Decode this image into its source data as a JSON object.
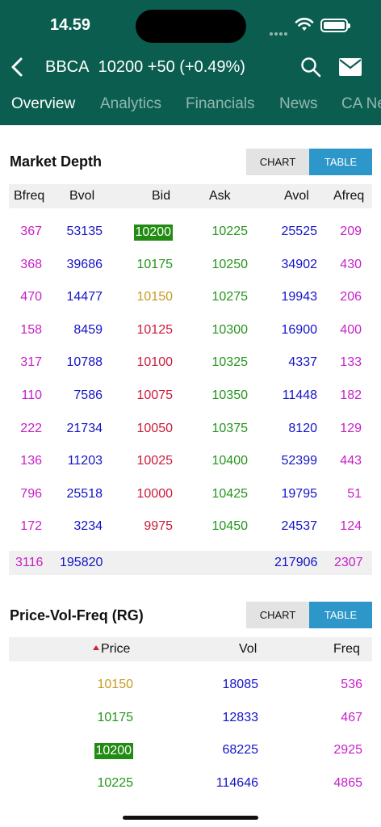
{
  "status_bar": {
    "time": "14.59"
  },
  "header": {
    "ticker": "BBCA",
    "quote": "10200 +50 (+0.49%)"
  },
  "tabs": [
    {
      "label": "Overview",
      "active": true
    },
    {
      "label": "Analytics",
      "active": false
    },
    {
      "label": "Financials",
      "active": false
    },
    {
      "label": "News",
      "active": false
    },
    {
      "label": "CA News",
      "active": false
    }
  ],
  "market_depth": {
    "title": "Market Depth",
    "toggle": {
      "chart": "CHART",
      "table": "TABLE",
      "selected": "TABLE"
    },
    "columns": [
      "Bfreq",
      "Bvol",
      "Bid",
      "Ask",
      "Avol",
      "Afreq"
    ],
    "rows": [
      {
        "bfreq": "367",
        "bvol": "53135",
        "bid": "10200",
        "ask": "10225",
        "avol": "25525",
        "afreq": "209"
      },
      {
        "bfreq": "368",
        "bvol": "39686",
        "bid": "10175",
        "ask": "10250",
        "avol": "34902",
        "afreq": "430"
      },
      {
        "bfreq": "470",
        "bvol": "14477",
        "bid": "10150",
        "ask": "10275",
        "avol": "19943",
        "afreq": "206"
      },
      {
        "bfreq": "158",
        "bvol": "8459",
        "bid": "10125",
        "ask": "10300",
        "avol": "16900",
        "afreq": "400"
      },
      {
        "bfreq": "317",
        "bvol": "10788",
        "bid": "10100",
        "ask": "10325",
        "avol": "4337",
        "afreq": "133"
      },
      {
        "bfreq": "110",
        "bvol": "7586",
        "bid": "10075",
        "ask": "10350",
        "avol": "11448",
        "afreq": "182"
      },
      {
        "bfreq": "222",
        "bvol": "21734",
        "bid": "10050",
        "ask": "10375",
        "avol": "8120",
        "afreq": "129"
      },
      {
        "bfreq": "136",
        "bvol": "11203",
        "bid": "10025",
        "ask": "10400",
        "avol": "52399",
        "afreq": "443"
      },
      {
        "bfreq": "796",
        "bvol": "25518",
        "bid": "10000",
        "ask": "10425",
        "avol": "19795",
        "afreq": "51"
      },
      {
        "bfreq": "172",
        "bvol": "3234",
        "bid": "9975",
        "ask": "10450",
        "avol": "24537",
        "afreq": "124"
      }
    ],
    "totals": {
      "bfreq": "3116",
      "bvol": "195820",
      "avol": "217906",
      "afreq": "2307"
    }
  },
  "price_vol_freq": {
    "title": "Price-Vol-Freq (RG)",
    "toggle": {
      "chart": "CHART",
      "table": "TABLE",
      "selected": "TABLE"
    },
    "columns": [
      "Price",
      "Vol",
      "Freq"
    ],
    "rows": [
      {
        "price": "10150",
        "vol": "18085",
        "freq": "536"
      },
      {
        "price": "10175",
        "vol": "12833",
        "freq": "467"
      },
      {
        "price": "10200",
        "vol": "68225",
        "freq": "2925"
      },
      {
        "price": "10225",
        "vol": "114646",
        "freq": "4865"
      }
    ]
  },
  "colors": {
    "header_bg": "#0b5e4f",
    "freq": "#c71fc7",
    "volume": "#1414c8",
    "up": "#23951c",
    "down": "#cc1a3a",
    "unchanged": "#c89a1e",
    "last_price_bg": "#228b14",
    "toggle_active": "#2c97c8"
  }
}
